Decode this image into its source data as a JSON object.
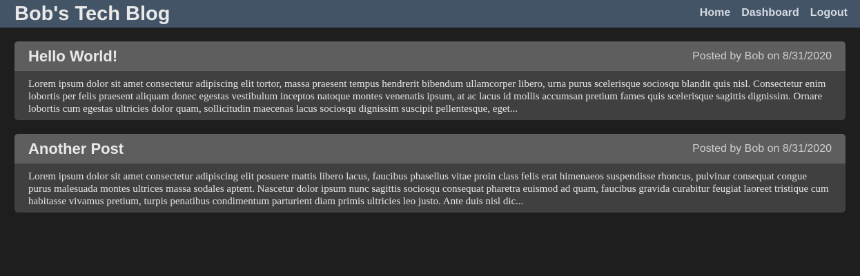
{
  "header": {
    "title": "Bob's Tech Blog",
    "nav": [
      {
        "label": "Home"
      },
      {
        "label": "Dashboard"
      },
      {
        "label": "Logout"
      }
    ]
  },
  "posts": [
    {
      "title": "Hello World!",
      "meta": "Posted by Bob on 8/31/2020",
      "body": "Lorem ipsum dolor sit amet consectetur adipiscing elit tortor, massa praesent tempus hendrerit bibendum ullamcorper libero, urna purus scelerisque sociosqu blandit quis nisl. Consectetur enim lobortis per felis praesent aliquam donec egestas vestibulum inceptos natoque montes venenatis ipsum, at ac lacus id mollis accumsan pretium fames quis scelerisque sagittis dignissim. Ornare lobortis cum egestas ultricies dolor quam, sollicitudin maecenas lacus sociosqu dignissim suscipit pellentesque, eget..."
    },
    {
      "title": "Another Post",
      "meta": "Posted by Bob on 8/31/2020",
      "body": "Lorem ipsum dolor sit amet consectetur adipiscing elit posuere mattis libero lacus, faucibus phasellus vitae proin class felis erat himenaeos suspendisse rhoncus, pulvinar consequat congue purus malesuada montes ultrices massa sodales aptent. Nascetur dolor ipsum nunc sagittis sociosqu consequat pharetra euismod ad quam, faucibus gravida curabitur feugiat laoreet tristique cum habitasse vivamus pretium, turpis penatibus condimentum parturient diam primis ultricies leo justo. Ante duis nisl dic..."
    }
  ],
  "colors": {
    "header_bg": "#435466",
    "page_bg": "#1e1e1e",
    "card_header_bg": "#5e5e5e",
    "card_body_bg": "#404040"
  }
}
